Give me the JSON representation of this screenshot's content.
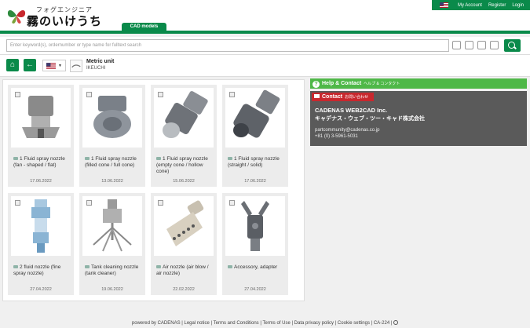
{
  "brand": {
    "kana": "フォグエンジニア",
    "name": "霧のいけうち"
  },
  "account": {
    "links": [
      "My Account",
      "Register",
      "Login"
    ]
  },
  "tabs": {
    "active": "CAD models"
  },
  "search": {
    "placeholder": "Enter keyword(s), ordernumber or type name for fulltext search"
  },
  "catalog": {
    "title": "Metric unit",
    "subtitle": "IKEUCHI"
  },
  "products": [
    {
      "name": "1 Fluid spray nozzle (fan - shaped / flat)",
      "date": "17.06.2022"
    },
    {
      "name": "1 Fluid spray nozzle (filled cone / full cone)",
      "date": "13.06.2022"
    },
    {
      "name": "1 Fluid spray nozzle (empty cone / hollow cone)",
      "date": "15.06.2022"
    },
    {
      "name": "1 Fluid spray nozzle (straight / solid)",
      "date": "17.06.2022"
    },
    {
      "name": "2 fluid nozzle (fine spray nozzle)",
      "date": "27.04.2022"
    },
    {
      "name": "Tank cleaning nozzle (tank cleaner)",
      "date": "19.06.2022"
    },
    {
      "name": "Air nozzle (air blow / air nozzle)",
      "date": "22.02.2022"
    },
    {
      "name": "Accessory, adapter",
      "date": "27.04.2022"
    }
  ],
  "help": {
    "title": "Help & Contact",
    "jp": "ヘルプ & コンタクト"
  },
  "contact": {
    "label": "Contact",
    "jp": "お問い合わせ",
    "company_en": "CADENAS WEB2CAD Inc.",
    "company_jp": "キャデナス・ウェブ・ツー・キャド株式会社",
    "email": "partcommunity@cadenas.co.jp",
    "phone": "+81 (0) 3-5961-5031"
  },
  "footer": {
    "text": "powered by CADENAS | Legal notice | Terms and Conditions | Terms of Use | Data privacy policy | Cookie settings | CA-224 |"
  },
  "colors": {
    "brand_green": "#0a8a4a",
    "help_green": "#4fb848",
    "contact_red": "#c8282e",
    "contact_bg": "#5a5a5a"
  }
}
